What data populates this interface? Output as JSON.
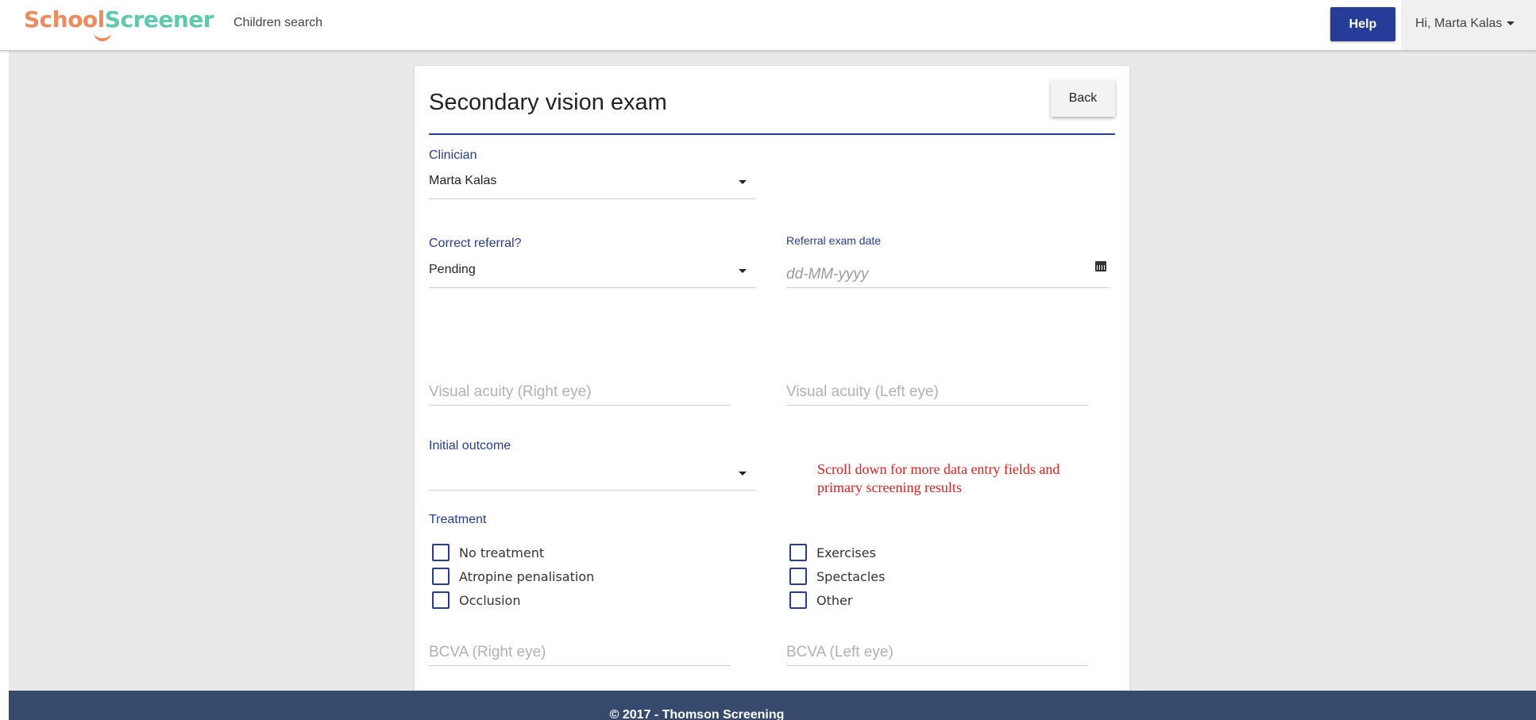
{
  "brand": {
    "part1": "School",
    "part2": "Screener",
    "primary_color": "#253d97",
    "accent_orange": "#ef8a5a",
    "accent_teal": "#5ec9ad"
  },
  "nav": {
    "children_search": "Children search"
  },
  "header": {
    "help_label": "Help",
    "user_greeting": "Hi, Marta Kalas"
  },
  "form": {
    "title": "Secondary vision exam",
    "back_label": "Back",
    "clinician": {
      "label": "Clinician",
      "value": "Marta Kalas"
    },
    "correct_referral": {
      "label": "Correct referral?",
      "value": "Pending"
    },
    "referral_exam_date": {
      "label": "Referral exam date",
      "placeholder": "dd-MM-yyyy",
      "icon": "calendar-icon"
    },
    "va_right": {
      "placeholder": "Visual acuity (Right eye)"
    },
    "va_left": {
      "placeholder": "Visual acuity (Left eye)"
    },
    "initial_outcome": {
      "label": "Initial outcome",
      "value": ""
    },
    "notice": "Scroll down for more data entry fields and primary screening results",
    "notice_color": "#e0201f",
    "treatment": {
      "label": "Treatment",
      "left_options": [
        {
          "label": "No treatment",
          "checked": false
        },
        {
          "label": "Atropine penalisation",
          "checked": false
        },
        {
          "label": "Occlusion",
          "checked": false
        }
      ],
      "right_options": [
        {
          "label": "Exercises",
          "checked": false
        },
        {
          "label": "Spectacles",
          "checked": false
        },
        {
          "label": "Other",
          "checked": false
        }
      ]
    },
    "bcva_right": {
      "placeholder": "BCVA (Right eye)"
    },
    "bcva_left": {
      "placeholder": "BCVA (Left eye)"
    }
  },
  "footer": {
    "copyright": "© 2017 - Thomson Screening"
  }
}
